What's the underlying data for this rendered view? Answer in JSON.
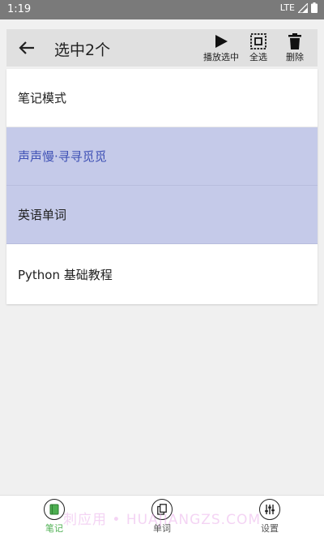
{
  "status_bar": {
    "time": "1:19",
    "network": "LTE"
  },
  "toolbar": {
    "title": "选中2个",
    "actions": [
      {
        "label": "播放选中",
        "icon": "play-icon"
      },
      {
        "label": "全选",
        "icon": "select-all-icon"
      },
      {
        "label": "删除",
        "icon": "trash-icon"
      }
    ]
  },
  "list": {
    "items": [
      {
        "label": "笔记模式",
        "selected": false
      },
      {
        "label": "声声慢·寻寻觅觅",
        "selected": true
      },
      {
        "label": "英语单词",
        "selected": true
      },
      {
        "label": "Python 基础教程",
        "selected": false
      }
    ]
  },
  "bottom_nav": {
    "items": [
      {
        "label": "笔记",
        "icon": "notebook-icon",
        "active": true
      },
      {
        "label": "单词",
        "icon": "copy-icon",
        "active": false
      },
      {
        "label": "设置",
        "icon": "sliders-icon",
        "active": false
      }
    ]
  },
  "watermark": "刺应用 • HUAJIANGZS.COM",
  "colors": {
    "accent": "#3f51b5",
    "selection": "#c5cae9",
    "active_nav": "#4caf50"
  }
}
